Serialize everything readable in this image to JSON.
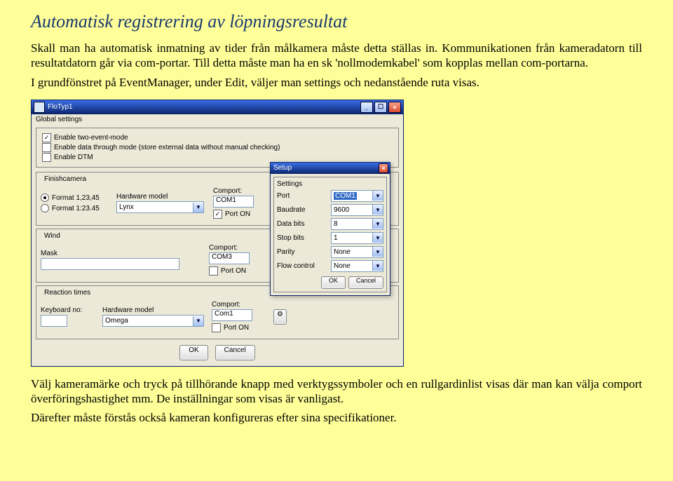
{
  "title": "Automatisk registrering av löpningsresultat",
  "para1": "Skall man ha automatisk inmatning av tider från målkamera måste detta ställas in. Kommunikationen från kameradatorn till resultatdatorn går via com-portar. Till detta måste man ha en sk 'nollmodemkabel' som kopplas mellan com-portarna.",
  "para2": "I grundfönstret på EventManager, under Edit, väljer man settings och nedanstående ruta visas.",
  "para3": "Välj kameramärke och tryck på tillhörande knapp med verktygssymboler och en rullgardinlist visas där man kan välja comport överföringshastighet mm. De inställningar som visas är vanligast.",
  "para4": "Därefter måste förstås också kameran konfigureras efter sina specifikationer.",
  "window": {
    "title": "FloTyp1",
    "global_label": "Global settings",
    "checks": {
      "c1": {
        "label": "Enable two-event-mode",
        "checked": true
      },
      "c2": {
        "label": "Enable data through mode (store external data without manual checking)",
        "checked": false
      },
      "c3": {
        "label": "Enable DTM",
        "checked": false
      }
    },
    "finishcamera": {
      "title": "Finishcamera",
      "format1": "Format 1,23,45",
      "format2": "Format 1:23.45",
      "hw_label": "Hardware model",
      "hw_value": "Lynx",
      "comport_label": "Comport:",
      "comport_value": "COM1",
      "porton": "Port ON"
    },
    "wind": {
      "title": "Wind",
      "mask_label": "Mask",
      "mask_value": "",
      "comport_label": "Comport:",
      "comport_value": "COM3",
      "porton": "Port ON"
    },
    "reaction": {
      "title": "Reaction times",
      "kbd_label": "Keyboard no:",
      "hw_label": "Hardware model",
      "hw_value": "Omega",
      "comport_label": "Comport:",
      "comport_value": "Com1",
      "porton": "Port ON"
    },
    "ok": "OK",
    "cancel": "Cancel"
  },
  "modal": {
    "title": "Setup",
    "settings": "Settings",
    "port_label": "Port",
    "port_value": "COM1",
    "baud_label": "Baudrate",
    "baud_value": "9600",
    "databits_label": "Data bits",
    "databits_value": "8",
    "stopbits_label": "Stop bits",
    "stopbits_value": "1",
    "parity_label": "Parity",
    "parity_value": "None",
    "flow_label": "Flow control",
    "flow_value": "None",
    "ok": "OK",
    "cancel": "Cancel"
  }
}
